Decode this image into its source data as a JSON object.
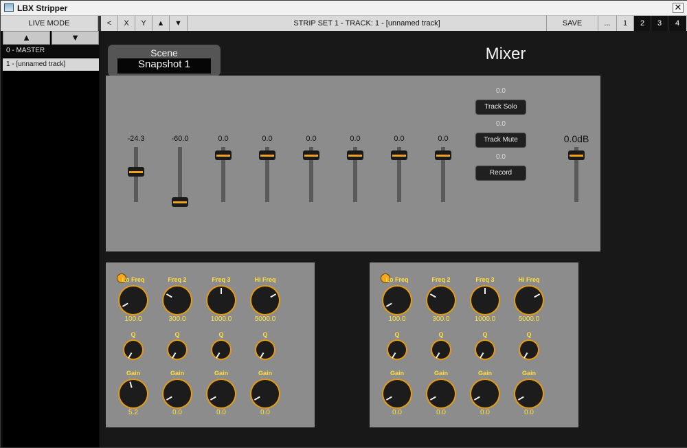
{
  "window": {
    "title": "LBX Stripper",
    "close_label": "✕"
  },
  "toolbar": {
    "live_mode": "LIVE MODE",
    "prev": "<",
    "x": "X",
    "y": "Y",
    "up": "▲",
    "down": "▼",
    "strip_title": "STRIP SET 1 - TRACK: 1 - [unnamed track]",
    "save": "SAVE",
    "more": "...",
    "pages": [
      "1",
      "2",
      "3",
      "4"
    ]
  },
  "sidebar": {
    "up_label": "▲",
    "down_label": "▼",
    "tracks": [
      "0 - MASTER",
      "1 - [unnamed track]"
    ]
  },
  "scene": {
    "label": "Scene",
    "value": "Snapshot 1"
  },
  "mixer": {
    "title": "Mixer",
    "faders": [
      {
        "value": "-24.3",
        "level": 0.55
      },
      {
        "value": "-60.0",
        "level": 0.0
      },
      {
        "value": "0.0",
        "level": 0.85
      },
      {
        "value": "0.0",
        "level": 0.85
      },
      {
        "value": "0.0",
        "level": 0.85
      },
      {
        "value": "0.0",
        "level": 0.85
      },
      {
        "value": "0.0",
        "level": 0.85
      },
      {
        "value": "0.0",
        "level": 0.85
      }
    ],
    "track_solo": {
      "value": "0.0",
      "label": "Track Solo"
    },
    "track_mute": {
      "value": "0.0",
      "label": "Track Mute"
    },
    "record": {
      "value": "0.0",
      "label": "Record"
    },
    "master": {
      "value": "0.0dB",
      "level": 0.85
    }
  },
  "eq_panels": [
    {
      "freq_labels": [
        "Lo Freq",
        "Freq 2",
        "Freq 3",
        "Hi Freq"
      ],
      "freq_values": [
        "100.0",
        "300.0",
        "1000.0",
        "5000.0"
      ],
      "q_label": "Q",
      "gain_label": "Gain",
      "gain_values": [
        "5.2",
        "0.0",
        "0.0",
        "0.0"
      ]
    },
    {
      "freq_labels": [
        "Lo Freq",
        "Freq 2",
        "Freq 3",
        "Hi Freq"
      ],
      "freq_values": [
        "100.0",
        "300.0",
        "1000.0",
        "5000.0"
      ],
      "q_label": "Q",
      "gain_label": "Gain",
      "gain_values": [
        "0.0",
        "0.0",
        "0.0",
        "0.0"
      ]
    }
  ],
  "colors": {
    "accent": "#f3a31b",
    "label_yellow": "#ffe03a",
    "panel": "#8c8c8c"
  }
}
